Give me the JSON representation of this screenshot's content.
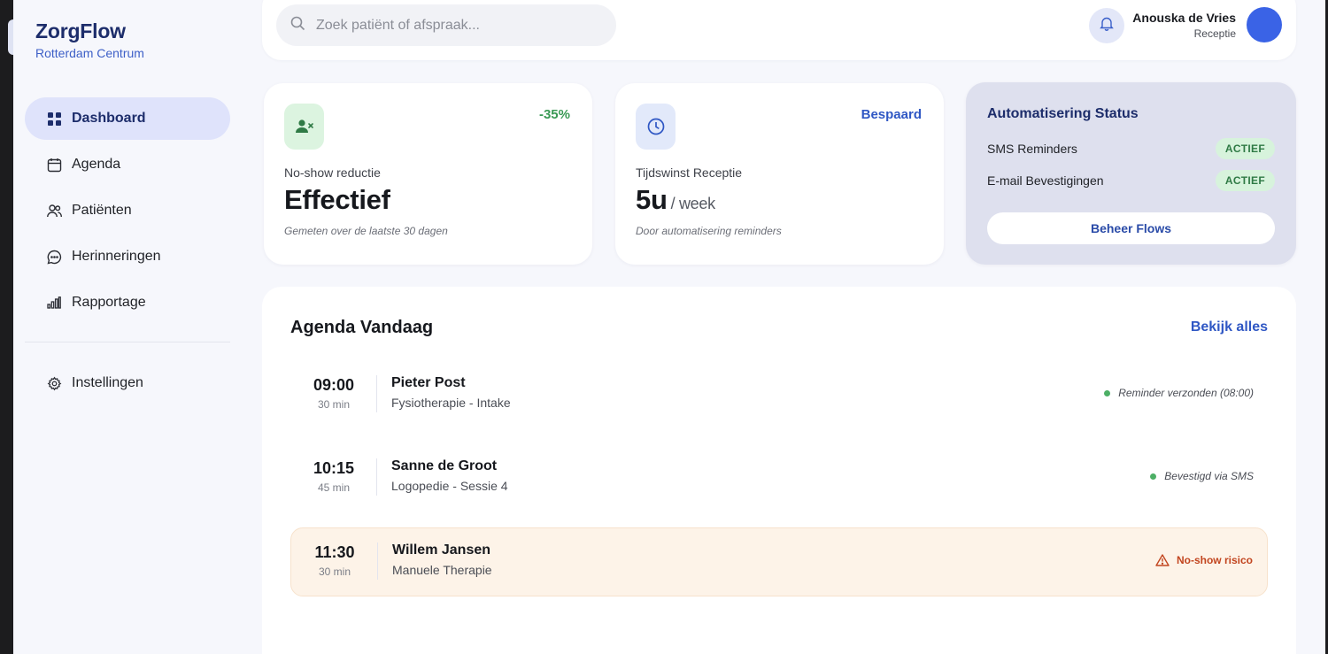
{
  "brand": {
    "name": "ZorgFlow",
    "location": "Rotterdam Centrum"
  },
  "nav": {
    "items": [
      {
        "label": "Dashboard",
        "icon": "grid-icon",
        "active": true
      },
      {
        "label": "Agenda",
        "icon": "calendar-icon"
      },
      {
        "label": "Patiënten",
        "icon": "users-icon"
      },
      {
        "label": "Herinneringen",
        "icon": "chat-icon"
      },
      {
        "label": "Rapportage",
        "icon": "bar-chart-icon"
      }
    ],
    "settings": {
      "label": "Instellingen",
      "icon": "gear-icon"
    }
  },
  "header": {
    "search_placeholder": "Zoek patiënt of afspraak...",
    "user_name": "Anouska de Vries",
    "user_role": "Receptie"
  },
  "stats": {
    "noshow": {
      "badge": "-35%",
      "label": "No-show reductie",
      "value": "Effectief",
      "note": "Gemeten over de laatste 30 dagen"
    },
    "time": {
      "badge": "Bespaard",
      "label": "Tijdswinst Receptie",
      "value": "5u",
      "unit": "/ week",
      "note": "Door automatisering reminders"
    }
  },
  "automation": {
    "title": "Automatisering Status",
    "rows": [
      {
        "label": "SMS Reminders",
        "status": "ACTIEF"
      },
      {
        "label": "E-mail Bevestigingen",
        "status": "ACTIEF"
      }
    ],
    "button": "Beheer Flows"
  },
  "agenda": {
    "title": "Agenda Vandaag",
    "view_all": "Bekijk alles",
    "appointments": [
      {
        "time": "09:00",
        "duration": "30 min",
        "name": "Pieter Post",
        "type": "Fysiotherapie - Intake",
        "status": "Reminder verzonden (08:00)"
      },
      {
        "time": "10:15",
        "duration": "45 min",
        "name": "Sanne de Groot",
        "type": "Logopedie - Sessie 4",
        "status": "Bevestigd via SMS"
      },
      {
        "time": "11:30",
        "duration": "30 min",
        "name": "Willem Jansen",
        "type": "Manuele Therapie",
        "status": "No-show risico"
      }
    ]
  },
  "colors": {
    "brand": "#1d2d6b",
    "accent": "#2f57c4",
    "success": "#3a9a55",
    "warning": "#c2451f"
  }
}
